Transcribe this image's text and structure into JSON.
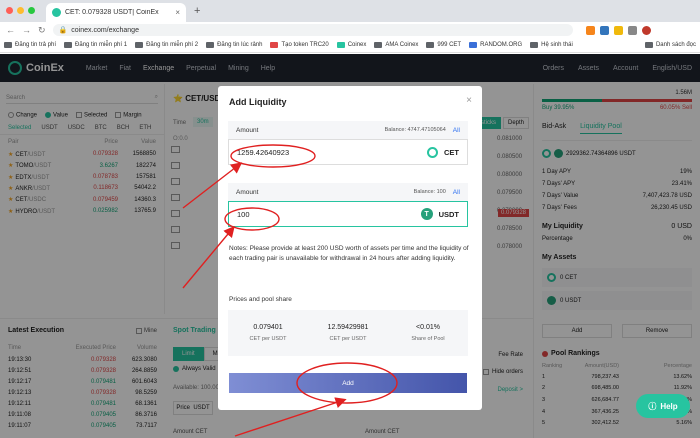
{
  "browser": {
    "tab_title": "CET: 0.079328 USDT| CoinEx",
    "url": "coinex.com/exchange",
    "bookmarks": [
      "Đăng tin trả phí",
      "Đăng tin miễn phí 1",
      "Đăng tin miễn phí 2",
      "Đăng tin lúc rảnh",
      "Tạo token TRC20",
      "Coinex",
      "AMA Coinex",
      "999 CET",
      "RANDOM.ORG",
      "Hệ sinh thái"
    ],
    "bookmarks_right": "Danh sách đọc"
  },
  "nav": {
    "logo": "CoinEx",
    "items": [
      "Market",
      "Fiat",
      "Exchange",
      "Perpetual",
      "Mining",
      "Help"
    ],
    "right_items": [
      "Orders",
      "Assets",
      "Account",
      "English/USD"
    ]
  },
  "market": {
    "search_placeholder": "Search",
    "radio_change": "Change",
    "radio_value": "Value",
    "check_selected": "Selected",
    "check_margin": "Margin",
    "tabs": [
      "Selected",
      "USDT",
      "USDC",
      "BTC",
      "BCH",
      "ETH"
    ],
    "headers": [
      "Pair",
      "Price",
      "Value"
    ],
    "rows": [
      {
        "pair": "CET",
        "quote": "/USDT",
        "price": "0.079328",
        "value": "1568850",
        "dir": "down"
      },
      {
        "pair": "TOMO",
        "quote": "/USDT",
        "price": "3.6267",
        "value": "182274",
        "dir": "up"
      },
      {
        "pair": "EDTX",
        "quote": "/USDT",
        "price": "0.078783",
        "value": "157581",
        "dir": "down"
      },
      {
        "pair": "ANKR",
        "quote": "/USDT",
        "price": "0.118673",
        "value": "54042.2",
        "dir": "down"
      },
      {
        "pair": "CET",
        "quote": "/USDC",
        "price": "0.079459",
        "value": "14360.3",
        "dir": "down"
      },
      {
        "pair": "HYDRO",
        "quote": "/USDT",
        "price": "0.025982",
        "value": "13765.9",
        "dir": "up"
      }
    ]
  },
  "chart": {
    "pair": "CET/USDT",
    "time_label": "Time",
    "timeframe": "30m",
    "ohlc_label": "O:0.0",
    "depth_buttons": [
      "sticks",
      "Depth"
    ],
    "y_ticks": [
      "0.081000",
      "0.080500",
      "0.080000",
      "0.079500",
      "0.079000",
      "0.078500",
      "0.078000"
    ],
    "current_price": "0.079328"
  },
  "execution": {
    "title": "Latest Execution",
    "mine_label": "Mine",
    "headers": [
      "Time",
      "Executed Price",
      "Volume"
    ],
    "rows": [
      {
        "time": "19:13:30",
        "price": "0.079328",
        "volume": "623.3080",
        "dir": "down"
      },
      {
        "time": "19:12:51",
        "price": "0.079328",
        "volume": "264.8859",
        "dir": "down"
      },
      {
        "time": "19:12:17",
        "price": "0.079481",
        "volume": "601.6043",
        "dir": "up"
      },
      {
        "time": "19:12:13",
        "price": "0.079328",
        "volume": "98.5259",
        "dir": "down"
      },
      {
        "time": "19:12:11",
        "price": "0.079481",
        "volume": "68.1361",
        "dir": "up"
      },
      {
        "time": "19:11:08",
        "price": "0.079405",
        "volume": "86.3716",
        "dir": "up"
      },
      {
        "time": "19:11:07",
        "price": "0.079405",
        "volume": "73.7117",
        "dir": "up"
      }
    ]
  },
  "spot": {
    "title": "Spot Trading",
    "tab_limit": "Limit",
    "tab_market": "Mar",
    "always_valid": "Always Valid",
    "available": "Available: 100.000",
    "price_label": "Price",
    "price_unit": "USDT",
    "fee_rate": "Fee Rate",
    "hide_orders": "Hide orders",
    "deposit": "Deposit >",
    "amount_left": "Amount",
    "amount_left_unit": "CET",
    "amount_right": "Amount",
    "amount_right_unit": "CET"
  },
  "right": {
    "buy_pct": "Buy  39.95%",
    "sell_pct": "60.05%  Sell",
    "top_value": "1.56M",
    "tabs": [
      "Bid-Ask",
      "Liquidity Pool"
    ],
    "pool_pair": "2929362.74364896 USDT",
    "stats": [
      {
        "k": "1 Day APY",
        "v": "19%"
      },
      {
        "k": "7 Days' APY",
        "v": "23.41%"
      },
      {
        "k": "7 Days' Value",
        "v": "7,407,423.78 USD"
      },
      {
        "k": "7 Days' Fees",
        "v": "26,230.45 USD"
      }
    ],
    "my_liquidity": "My Liquidity",
    "my_liquidity_val": "0 USD",
    "percentage": "Percentage",
    "percentage_val": "0%",
    "my_assets": "My Assets",
    "asset_cet": "0 CET",
    "asset_usdt": "0 USDT",
    "add_btn": "Add",
    "remove_btn": "Remove",
    "rankings_title": "Pool Rankings",
    "rank_headers": [
      "Ranking",
      "Amount(USD)",
      "Percentage"
    ],
    "ranks": [
      {
        "r": "1",
        "a": "798,237.43",
        "p": "13.62%"
      },
      {
        "r": "2",
        "a": "698,485.00",
        "p": "11.92%"
      },
      {
        "r": "3",
        "a": "626,684.77",
        "p": "10.70%"
      },
      {
        "r": "4",
        "a": "367,436.25",
        "p": "6.27%"
      },
      {
        "r": "5",
        "a": "302,412.52",
        "p": "5.16%"
      }
    ]
  },
  "modal": {
    "title": "Add Liquidity",
    "amount1_label": "Amount",
    "amount1_balance": "Balance: 4747.47105064",
    "amount1_all": "All",
    "amount1_value": "1259.42640923",
    "amount1_currency": "CET",
    "amount2_label": "Amount",
    "amount2_balance": "Balance: 100",
    "amount2_all": "All",
    "amount2_value": "100",
    "amount2_currency": "USDT",
    "notes": "Notes: Please provide at least 200 USD worth of assets per time and the liquidity of each trading pair is unavailable for withdrawal in 24 hours after adding liquidity.",
    "pps_title": "Prices and pool share",
    "pps": [
      {
        "value": "0.079401",
        "label": "CET per USDT"
      },
      {
        "value": "12.59429981",
        "label": "CET per USDT"
      },
      {
        "value": "<0.01%",
        "label": "Share of Pool"
      }
    ],
    "add_button": "Add"
  },
  "help": {
    "label": "Help"
  },
  "colors": {
    "accent": "#27c4a0",
    "up": "#12a578",
    "down": "#e04646",
    "annotation": "#e02020",
    "navbar": "#1f2530"
  }
}
